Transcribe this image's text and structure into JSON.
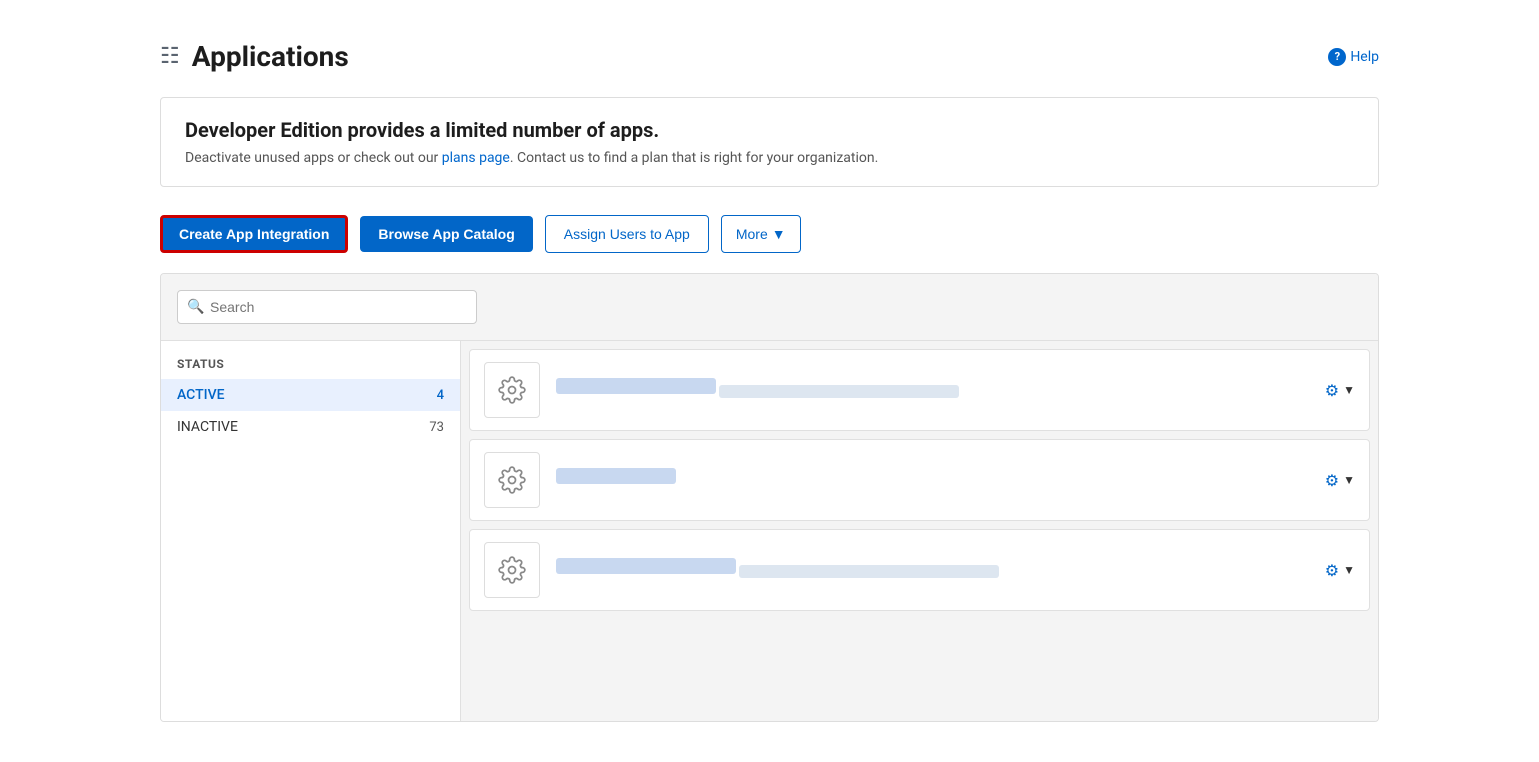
{
  "header": {
    "title": "Applications",
    "help_label": "Help"
  },
  "banner": {
    "heading": "Developer Edition provides a limited number of apps.",
    "body_text": "Deactivate unused apps or check out our ",
    "link_text": "plans page",
    "body_text2": ". Contact us to find a plan that is right for your organization."
  },
  "actions": {
    "create_label": "Create App Integration",
    "browse_label": "Browse App Catalog",
    "assign_label": "Assign Users to App",
    "more_label": "More"
  },
  "search": {
    "placeholder": "Search"
  },
  "sidebar": {
    "section_title": "STATUS",
    "items": [
      {
        "label": "ACTIVE",
        "count": "4",
        "active": true
      },
      {
        "label": "INACTIVE",
        "count": "73",
        "active": false
      }
    ]
  },
  "apps": [
    {
      "id": 1
    },
    {
      "id": 2
    },
    {
      "id": 3
    }
  ],
  "colors": {
    "primary": "#0266c8",
    "danger_border": "#cc0000"
  }
}
